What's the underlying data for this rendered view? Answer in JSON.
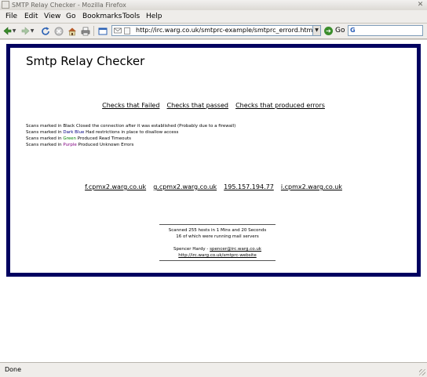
{
  "window": {
    "title": "SMTP Relay Checker - Mozilla Firefox",
    "close_glyph": "✕"
  },
  "menu": [
    "File",
    "Edit",
    "View",
    "Go",
    "Bookmarks",
    "Tools",
    "Help"
  ],
  "toolbar": {
    "url": "http://irc.warg.co.uk/smtprc-example/smtprc_errord.html",
    "go_label": "Go",
    "search_value": ""
  },
  "page": {
    "title": "Smtp Relay Checker",
    "nav_links": [
      "Checks that Failed",
      "Checks that passed",
      "Checks that produced errors"
    ],
    "legend": [
      {
        "prefix": "Scans marked in ",
        "color_word": "Black",
        "color": "#000000",
        "suffix": " Closed the connection after it was established (Probably due to a firewall)"
      },
      {
        "prefix": "Scans marked in ",
        "color_word": "Dark Blue",
        "color": "#000080",
        "suffix": " Had restrictions in place to disallow access"
      },
      {
        "prefix": "Scans marked in ",
        "color_word": "Green",
        "color": "#008000",
        "suffix": " Produced Read Timeouts"
      },
      {
        "prefix": "Scans marked in ",
        "color_word": "Purple",
        "color": "#800080",
        "suffix": " Produced Unknown Errors"
      }
    ],
    "hosts": [
      "f.cpmx2.warg.co.uk",
      "g.cpmx2.warg.co.uk",
      "195.157.194.77",
      "i.cpmx2.warg.co.uk"
    ],
    "footer": {
      "scanned": "Scanned 255 hosts in 1 Mins and 20 Seconds",
      "mail_servers": "16 of which were running mail servers",
      "author_prefix": "Spencer Hardy - ",
      "author_email": "spencer@irc.warg.co.uk",
      "website": "http://irc.warg.co.uk/smtprc-website"
    }
  },
  "status": {
    "text": "Done"
  },
  "colors": {
    "frame_border": "#000060",
    "chrome": "#efedea"
  }
}
